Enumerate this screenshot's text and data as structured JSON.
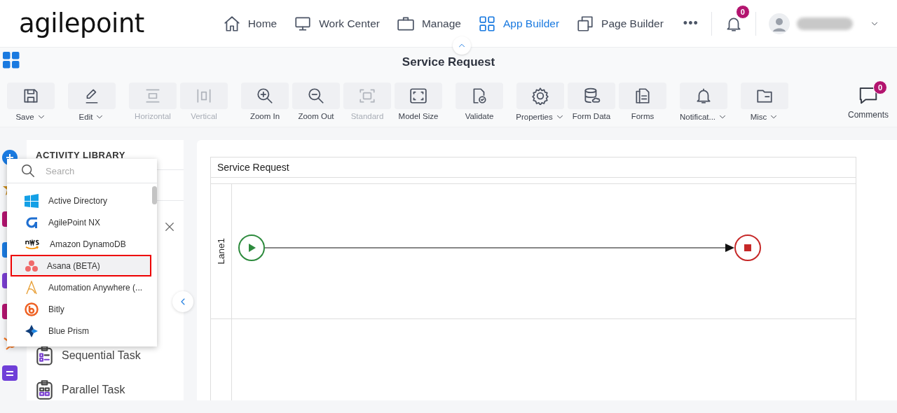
{
  "header": {
    "logo": "agilepoint",
    "nav": [
      {
        "label": "Home",
        "selected": false
      },
      {
        "label": "Work Center",
        "selected": false
      },
      {
        "label": "Manage",
        "selected": false
      },
      {
        "label": "App Builder",
        "selected": true
      },
      {
        "label": "Page Builder",
        "selected": false
      }
    ],
    "more": "•••",
    "notifications": "0"
  },
  "title": "Service Request",
  "toolbar": [
    [
      {
        "label": "Save",
        "dropdown": true,
        "disabled": false
      }
    ],
    [
      {
        "label": "Edit",
        "dropdown": true,
        "disabled": false
      }
    ],
    [
      {
        "label": "Horizontal",
        "dropdown": false,
        "disabled": true
      },
      {
        "label": "Vertical",
        "dropdown": false,
        "disabled": true
      }
    ],
    [
      {
        "label": "Zoom In",
        "dropdown": false,
        "disabled": false
      },
      {
        "label": "Zoom Out",
        "dropdown": false,
        "disabled": false
      },
      {
        "label": "Standard",
        "dropdown": false,
        "disabled": true
      },
      {
        "label": "Model Size",
        "dropdown": false,
        "disabled": false
      }
    ],
    [
      {
        "label": "Validate",
        "dropdown": false,
        "disabled": false
      }
    ],
    [
      {
        "label": "Properties",
        "dropdown": true,
        "disabled": false
      },
      {
        "label": "Form Data",
        "dropdown": false,
        "disabled": false
      },
      {
        "label": "Forms",
        "dropdown": false,
        "disabled": false
      }
    ],
    [
      {
        "label": "Notificat...",
        "dropdown": true,
        "disabled": false
      }
    ],
    [
      {
        "label": "Misc",
        "dropdown": true,
        "disabled": false
      }
    ]
  ],
  "comments": {
    "label": "Comments",
    "badge": "0"
  },
  "library": {
    "title": "ACTIVITY LIBRARY",
    "items": [
      "Sequential Task",
      "Parallel Task"
    ]
  },
  "dropdown": {
    "placeholder": "Search",
    "items": [
      {
        "label": "Active Directory",
        "selected": false
      },
      {
        "label": "AgilePoint NX",
        "selected": false
      },
      {
        "label": "Amazon DynamoDB",
        "selected": false
      },
      {
        "label": "Asana (BETA)",
        "selected": true
      },
      {
        "label": "Automation Anywhere (...",
        "selected": false
      },
      {
        "label": "Bitly",
        "selected": false
      },
      {
        "label": "Blue Prism",
        "selected": false
      }
    ]
  },
  "canvas": {
    "pool": "Service Request",
    "lanes": [
      "Lane1"
    ]
  }
}
